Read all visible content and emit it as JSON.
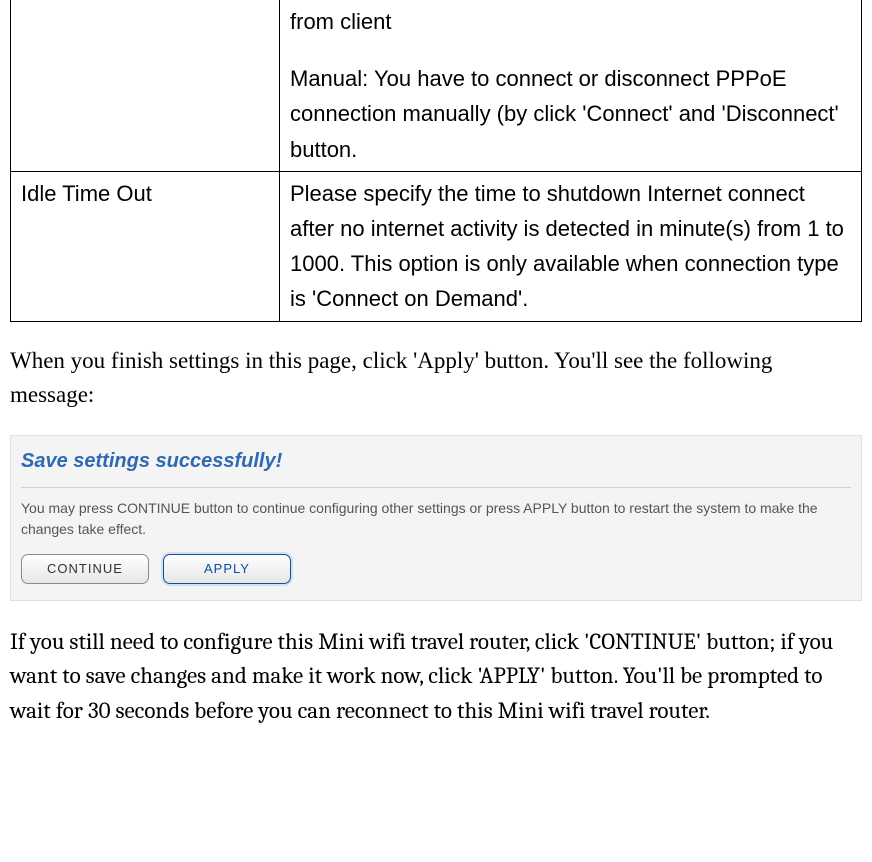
{
  "table": {
    "row1": {
      "label": "",
      "line1": "from client",
      "line2": "Manual: You have to connect or disconnect PPPoE connection manually (by click 'Connect' and 'Disconnect' button."
    },
    "row2": {
      "label": "Idle Time Out",
      "text": "Please specify the time to shutdown Internet connect after no internet activity is detected in minute(s) from 1 to 1000. This option is only available when connection type is 'Connect on Demand'."
    }
  },
  "paragraphs": {
    "before": "When you finish settings in this page, click 'Apply' button. You'll see the following message:",
    "after": "If you still need to configure this Mini wifi travel router, click 'CONTINUE' button; if you want to save changes and make it work now, click 'APPLY' button. You'll be prompted to wait for 30 seconds before you can reconnect to this Mini wifi travel router."
  },
  "screenshot": {
    "title": "Save settings successfully!",
    "text": "You may press CONTINUE button to continue configuring other settings or press APPLY button to restart the system to make the changes take effect.",
    "buttons": {
      "continue": "CONTINUE",
      "apply": "APPLY"
    }
  }
}
